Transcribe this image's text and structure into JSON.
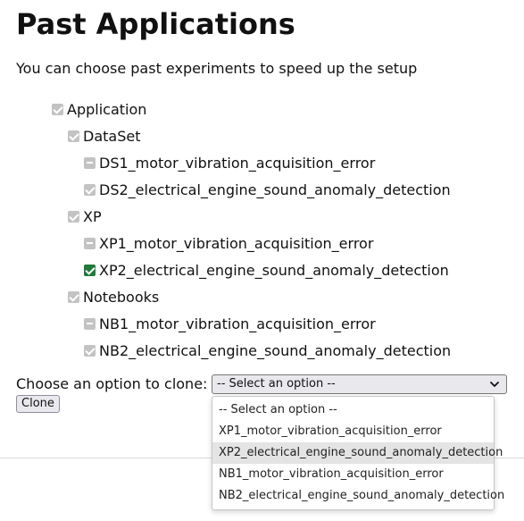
{
  "page": {
    "title": "Past Applications",
    "subtitle": "You can choose past experiments to speed up the setup"
  },
  "tree": {
    "root": {
      "label": "Application",
      "state": "checked-disabled"
    },
    "dataset": {
      "label": "DataSet",
      "state": "checked-disabled",
      "items": [
        {
          "label": "DS1_motor_vibration_acquisition_error",
          "state": "indeterminate"
        },
        {
          "label": "DS2_electrical_engine_sound_anomaly_detection",
          "state": "checked-disabled"
        }
      ]
    },
    "xp": {
      "label": "XP",
      "state": "checked-disabled",
      "items": [
        {
          "label": "XP1_motor_vibration_acquisition_error",
          "state": "indeterminate"
        },
        {
          "label": "XP2_electrical_engine_sound_anomaly_detection",
          "state": "checked"
        }
      ]
    },
    "notebooks": {
      "label": "Notebooks",
      "state": "checked-disabled",
      "items": [
        {
          "label": "NB1_motor_vibration_acquisition_error",
          "state": "indeterminate"
        },
        {
          "label": "NB2_electrical_engine_sound_anomaly_detection",
          "state": "checked-disabled"
        }
      ]
    }
  },
  "clone": {
    "label": "Choose an option to clone:",
    "selected": "-- Select an option --",
    "button_label": "Clone",
    "options": [
      "-- Select an option --",
      "XP1_motor_vibration_acquisition_error",
      "XP2_electrical_engine_sound_anomaly_detection",
      "NB1_motor_vibration_acquisition_error",
      "NB2_electrical_engine_sound_anomaly_detection"
    ],
    "highlighted_option": "XP2_electrical_engine_sound_anomaly_detection"
  },
  "colors": {
    "checked_accent": "#1f7a3a",
    "disabled_check": "#c3c3c3",
    "hover_option": "#e4e4e4"
  }
}
